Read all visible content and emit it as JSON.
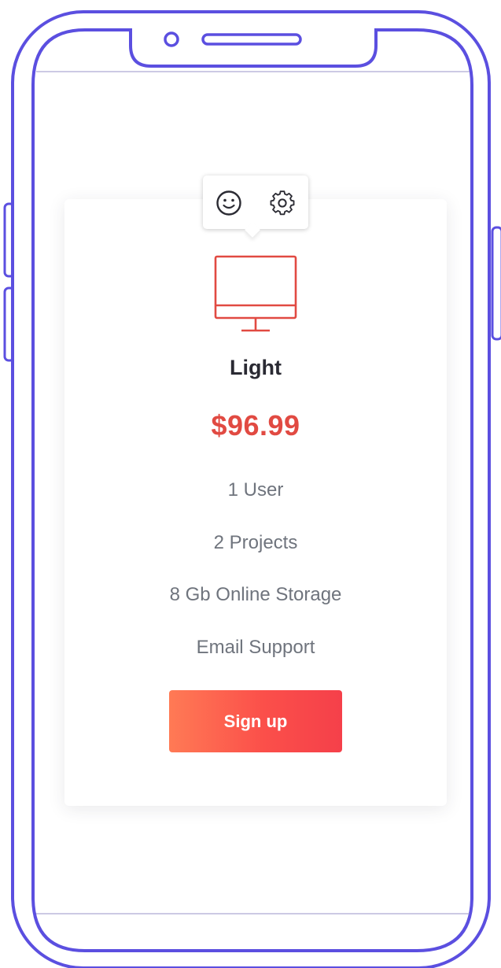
{
  "device": {
    "frame_color": "#5b4fe0"
  },
  "toolbar": {
    "icons": [
      "smile-icon",
      "gear-icon"
    ]
  },
  "pricing_card": {
    "icon": "monitor-icon",
    "accent_color": "#e14a42",
    "plan_name": "Light",
    "price": "$96.99",
    "features": [
      "1 User",
      "2 Projects",
      "8 Gb Online Storage",
      "Email Support"
    ],
    "cta_label": "Sign up",
    "cta_gradient": [
      "#ff7a55",
      "#f5404a"
    ]
  }
}
